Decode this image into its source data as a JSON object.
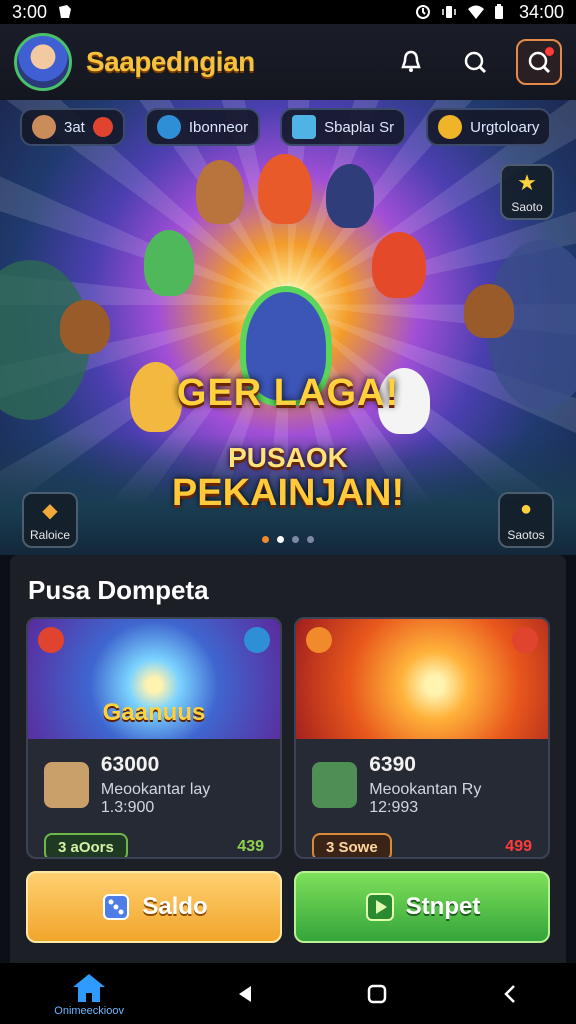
{
  "status_bar": {
    "time_left": "3:00",
    "time_right": "34:00"
  },
  "header": {
    "title": "Saapedngian"
  },
  "chips": [
    {
      "label": "3at",
      "icon": "profile-icon"
    },
    {
      "label": "Ibonneor",
      "icon": "shield-icon"
    },
    {
      "label": "Sbaplaı Sr",
      "icon": "gem-icon"
    },
    {
      "label": "Urgtoloary",
      "icon": "trophy-icon"
    }
  ],
  "hero": {
    "title": "GER LAGA!",
    "subtitle1": "PUSAOK",
    "subtitle2": "PEKAINJAN!",
    "side_left": "Raloice",
    "side_right_top": "Saoto",
    "side_right_bottom": "Saotos"
  },
  "wallet": {
    "title": "Pusa Dompeta",
    "cards": [
      {
        "banner": "Gaanuus",
        "amount": "63000",
        "desc": "Meookantar lay 1.3:900",
        "pill": "3 aOors",
        "price": "439",
        "price_color": "#8fd14f"
      },
      {
        "banner": "",
        "amount": "6390",
        "desc": "Meookantan Ry 12:993",
        "pill": "3 Sowe",
        "price": "499",
        "price_color": "#ff3b3b"
      }
    ],
    "saldo_label": "Saldo",
    "setor_label": "Stnpet"
  },
  "nav": {
    "home_label": "Onimeeckioov"
  }
}
